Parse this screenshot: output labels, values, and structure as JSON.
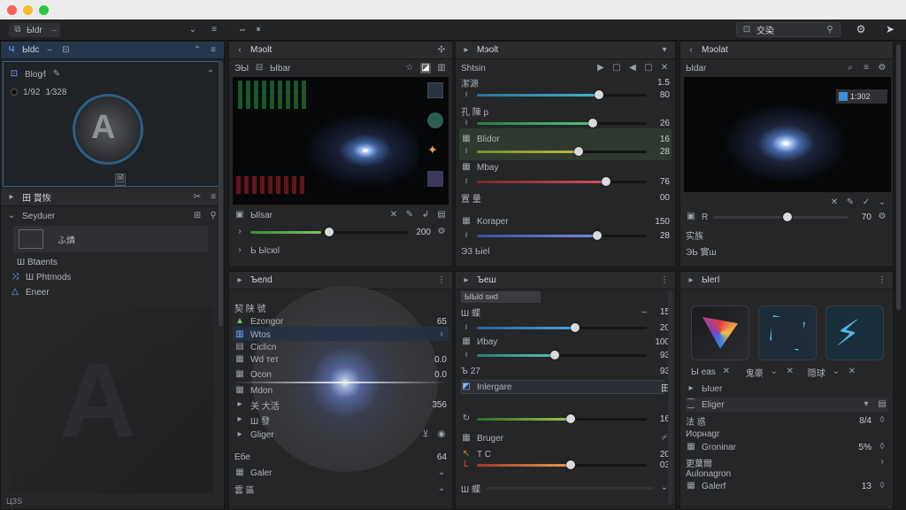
{
  "toolbar": {
    "tab1": "Ыdr",
    "search_value": "交染"
  },
  "left_panel": {
    "header_label": "Ыdc",
    "item_blog": "Blog⁄l",
    "value_a": "1/92",
    "value_b": "1∕328",
    "section_title": "田 賞恢",
    "browser_label": "Seyduer",
    "asset_label": "ふ燐",
    "sub_label": "Ш Btaents",
    "list": [
      {
        "label": "Ш Phtmods"
      },
      {
        "label": "Eneer"
      }
    ],
    "footer": "ЦЗS"
  },
  "panel_a": {
    "title": "Мэоlt",
    "tab1": "ЭЫ",
    "tab2": "Ыbar",
    "section": "Ыlsar",
    "value": "200",
    "footer": "Ь Ысюl"
  },
  "panel_b": {
    "title": "Мэоlt",
    "sub": "Shtsin",
    "rows": [
      {
        "label": "潔源",
        "value": "1.5"
      },
      {
        "label": "",
        "value": "80"
      },
      {
        "label": "孔 陳 p",
        "value": ""
      },
      {
        "label": "",
        "value": "26"
      },
      {
        "label": "Blidor",
        "value": "16"
      },
      {
        "label": "",
        "value": "28"
      },
      {
        "label": "Mbay",
        "value": ""
      },
      {
        "label": "",
        "value": "76"
      },
      {
        "label": "置 量",
        "value": "00"
      },
      {
        "label": "Koraper",
        "value": "150"
      },
      {
        "label": "",
        "value": "28"
      },
      {
        "label": "ЭЗ Ьiel",
        "value": ""
      }
    ]
  },
  "panel_c": {
    "title": "Мэоlat",
    "sub": "Ыdar",
    "badge": "1:302",
    "r_label": "R",
    "r_value": "70",
    "f1": "实族",
    "f2": "ЭЬ 實ш"
  },
  "panel_d": {
    "title": "Ъелd",
    "items": [
      {
        "label": "契 陕 號",
        "value": ""
      },
      {
        "label": "Ezongor",
        "value": "65"
      },
      {
        "label": "Wtos",
        "value": ""
      },
      {
        "label": "Ciclicn",
        "value": ""
      },
      {
        "label": "Wd тет",
        "value": "0.0"
      },
      {
        "label": "Ocon",
        "value": "0.0"
      },
      {
        "label": "Мdon",
        "value": ""
      },
      {
        "label": "关 大活",
        "value": "356"
      },
      {
        "label": "Ш 發",
        "value": ""
      },
      {
        "label": "Gliger",
        "value": ""
      },
      {
        "label": "Ебе",
        "value": "64"
      },
      {
        "label": "Galer",
        "value": ""
      },
      {
        "label": "雲 區",
        "value": ""
      }
    ]
  },
  "panel_e": {
    "title": "Ъеш",
    "sub": "ЫЫd  sнd",
    "rows": [
      {
        "label": "Ш 蝶",
        "value": "15"
      },
      {
        "label": "",
        "value": "20"
      },
      {
        "label": "Иbay",
        "value": "100"
      },
      {
        "label": "",
        "value": "93"
      },
      {
        "label": "Ъ 27",
        "value": "93"
      },
      {
        "label": "Inlergare",
        "value": "田"
      },
      {
        "label": "",
        "value": "16"
      },
      {
        "label": "Bruger",
        "value": ""
      },
      {
        "label": "T C",
        "value": "20"
      },
      {
        "label": "",
        "value": "03"
      },
      {
        "label": "Ш 蝶",
        "value": ""
      }
    ]
  },
  "panel_f": {
    "title": "Ыeгl",
    "thumbs": [
      "Ы eas",
      "鬼豪",
      "隠球"
    ],
    "section": "Ыuer",
    "group": "Eliger",
    "rows": [
      {
        "label": "法 惑",
        "value": "8/4"
      },
      {
        "label": "Иорнаgr",
        "value": ""
      },
      {
        "label": "Groninar",
        "value": "5%"
      },
      {
        "label": "更葉爾",
        "value": ""
      },
      {
        "label": "Aulonagron",
        "value": ""
      },
      {
        "label": "Galerf",
        "value": "13"
      }
    ]
  }
}
